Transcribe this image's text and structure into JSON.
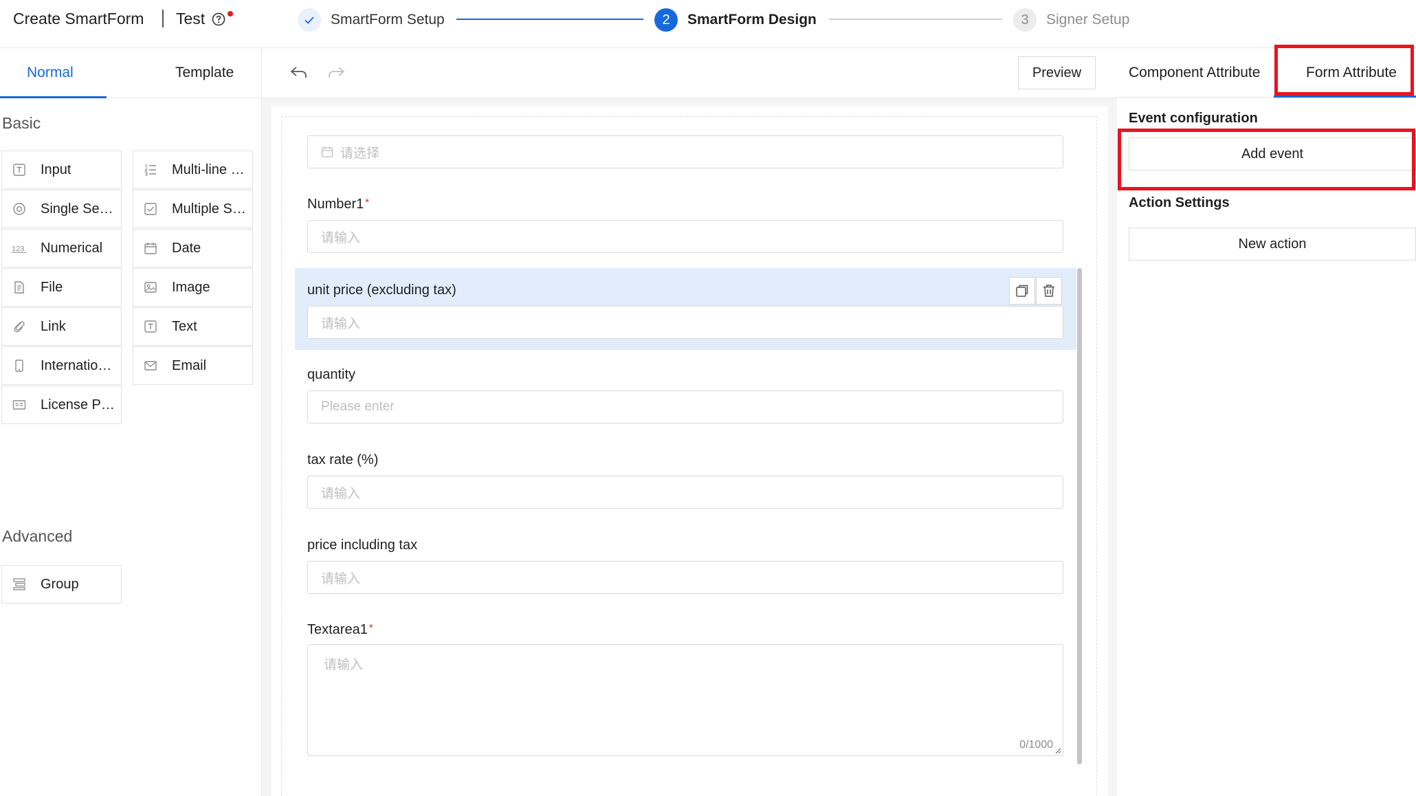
{
  "header": {
    "app_title": "Create SmartForm",
    "doc_title": "Test",
    "steps": [
      {
        "number": "✓",
        "label": "SmartForm Setup",
        "state": "done"
      },
      {
        "number": "2",
        "label": "SmartForm Design",
        "state": "active"
      },
      {
        "number": "3",
        "label": "Signer Setup",
        "state": "pending"
      }
    ]
  },
  "left_panel": {
    "tabs": [
      "Normal",
      "Template"
    ],
    "sections": {
      "basic_title": "Basic",
      "advanced_title": "Advanced"
    },
    "basic_components": [
      {
        "label": "Input",
        "icon": "input-icon"
      },
      {
        "label": "Multi-line Input",
        "icon": "multiline-icon"
      },
      {
        "label": "Single Select",
        "icon": "radio-icon"
      },
      {
        "label": "Multiple Select",
        "icon": "checkbox-icon"
      },
      {
        "label": "Numerical",
        "icon": "numeric-icon"
      },
      {
        "label": "Date",
        "icon": "calendar-icon"
      },
      {
        "label": "File",
        "icon": "file-icon"
      },
      {
        "label": "Image",
        "icon": "image-icon"
      },
      {
        "label": "Link",
        "icon": "link-icon"
      },
      {
        "label": "Text",
        "icon": "text-icon"
      },
      {
        "label": "International Phone",
        "icon": "phone-icon"
      },
      {
        "label": "Email",
        "icon": "email-icon"
      },
      {
        "label": "License Plate",
        "icon": "license-icon"
      }
    ],
    "advanced_components": [
      {
        "label": "Group",
        "icon": "group-icon"
      }
    ]
  },
  "toolbar": {
    "preview_label": "Preview"
  },
  "canvas": {
    "date_placeholder": "请选择",
    "fields": [
      {
        "label": "Number1",
        "required": "*",
        "placeholder": "请输入"
      },
      {
        "label": "unit price (excluding tax)",
        "required": "",
        "placeholder": "请输入"
      },
      {
        "label": "quantity",
        "required": "",
        "placeholder": "Please enter"
      },
      {
        "label": "tax rate (%)",
        "required": "",
        "placeholder": "请输入"
      },
      {
        "label": "price including tax",
        "required": "",
        "placeholder": "请输入"
      }
    ],
    "textarea": {
      "label": "Textarea1",
      "required": "*",
      "placeholder": "请输入",
      "counter": "0/1000"
    }
  },
  "right_panel": {
    "tabs": [
      "Component Attribute",
      "Form Attribute"
    ],
    "event_title": "Event configuration",
    "add_event_label": "Add event",
    "action_title": "Action Settings",
    "new_action_label": "New action"
  },
  "colors": {
    "primary": "#1668dc",
    "highlight_box": "#e8141e",
    "selected_bg": "#e1edfb",
    "required": "#e02020"
  }
}
